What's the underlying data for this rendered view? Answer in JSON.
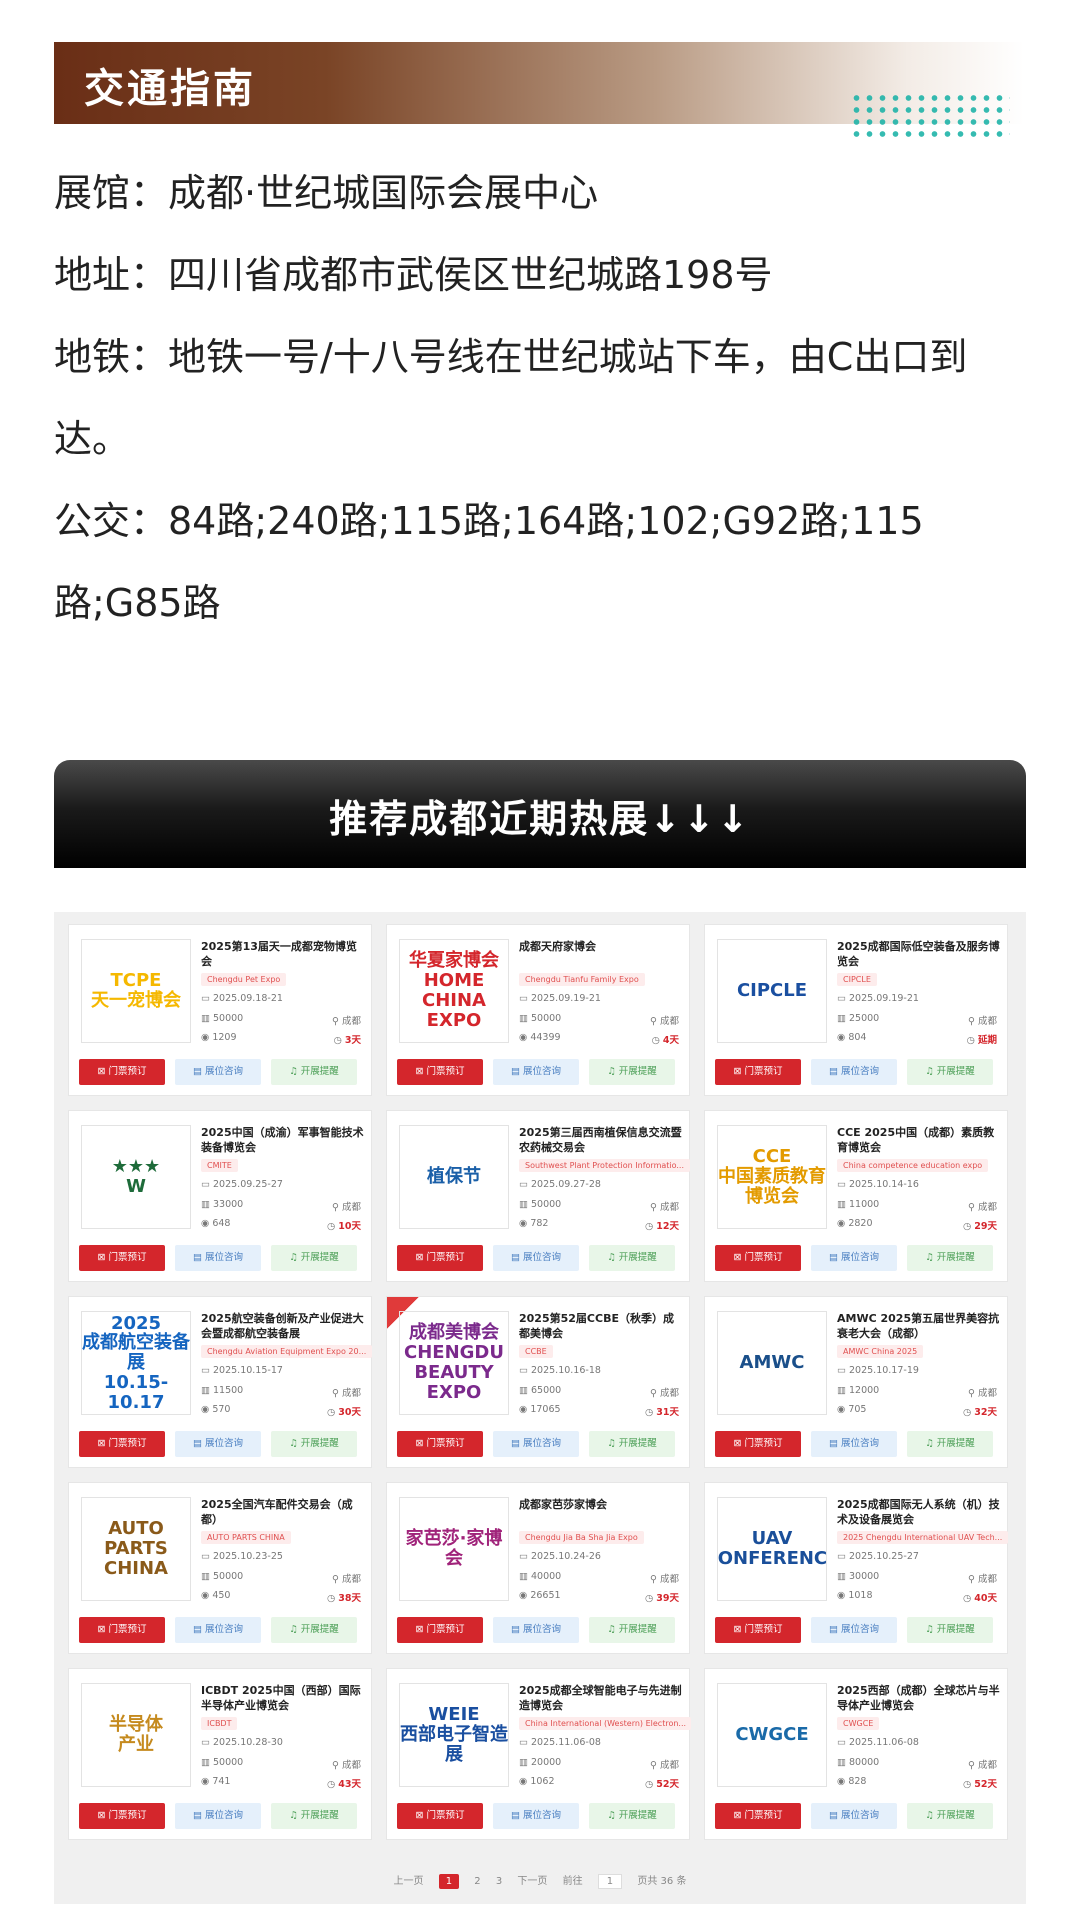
{
  "section_title": "交通指南",
  "venue": {
    "hall": "展馆：成都·世纪城国际会展中心",
    "address": "地址：四川省成都市武侯区世纪城路198号",
    "metro": "地铁：地铁一号/十八号线在世纪城站下车，由C出口到达。",
    "bus": "公交：84路;240路;115路;164路;102;G92路;115路;G85路"
  },
  "recommend_title": "推荐成都近期热展↓↓↓",
  "button_labels": {
    "ticket": "门票预订",
    "booth": "展位咨询",
    "remind": "开展提醒"
  },
  "cards": [
    {
      "logo": "TCPE\n天一宠博会",
      "logo_color": "#f5b800",
      "title": "2025第13届天一成都宠物博览会",
      "tag": "Chengdu Pet Expo",
      "date": "2025.09.18-21",
      "area": "50000",
      "city": "成都",
      "views": "1209",
      "days": "3天"
    },
    {
      "logo": "华夏家博会\nHOME CHINA EXPO",
      "logo_color": "#d4262c",
      "title": "成都天府家博会",
      "tag": "Chengdu Tianfu Family Expo",
      "date": "2025.09.19-21",
      "area": "50000",
      "city": "成都",
      "views": "44399",
      "days": "4天"
    },
    {
      "logo": "CIPCLE",
      "logo_color": "#1a4fa0",
      "title": "2025成都国际低空装备及服务博览会",
      "tag": "CIPCLE",
      "date": "2025.09.19-21",
      "area": "25000",
      "city": "成都",
      "views": "804",
      "days": "延期"
    },
    {
      "logo": "★★★\nW",
      "logo_color": "#1e6b3a",
      "title": "2025中国（成渝）军事智能技术装备博览会",
      "tag": "CMITE",
      "date": "2025.09.25-27",
      "area": "33000",
      "city": "成都",
      "views": "648",
      "days": "10天"
    },
    {
      "logo": "植保节",
      "logo_color": "#1a5fa8",
      "title": "2025第三届西南植保信息交流暨农药械交易会",
      "tag": "Southwest Plant Protection Informatio...",
      "date": "2025.09.27-28",
      "area": "50000",
      "city": "成都",
      "views": "782",
      "days": "12天"
    },
    {
      "logo": "CCE\n中国素质教育博览会",
      "logo_color": "#e39b00",
      "title": "CCE 2025中国（成都）素质教育博览会",
      "tag": "China competence education expo",
      "date": "2025.10.14-16",
      "area": "11000",
      "city": "成都",
      "views": "2820",
      "days": "29天"
    },
    {
      "logo": "2025\n成都航空装备展\n10.15-10.17",
      "logo_color": "#1565c0",
      "title": "2025航空装备创新及产业促进大会暨成都航空装备展",
      "tag": "Chengdu Aviation Equipment Expo 20...",
      "date": "2025.10.15-17",
      "area": "11500",
      "city": "成都",
      "views": "570",
      "days": "30天"
    },
    {
      "logo": "成都美博会\nCHENGDU\nBEAUTY EXPO",
      "logo_color": "#7b2a8c",
      "title": "2025第52届CCBE（秋季）成都美博会",
      "tag": "CCBE",
      "date": "2025.10.16-18",
      "area": "65000",
      "city": "成都",
      "views": "17065",
      "days": "31天"
    },
    {
      "logo": "AMWC",
      "logo_color": "#1a4f8a",
      "title": "AMWC 2025第五届世界美容抗衰老大会（成都）",
      "tag": "AMWC China 2025",
      "date": "2025.10.17-19",
      "area": "12000",
      "city": "成都",
      "views": "705",
      "days": "32天"
    },
    {
      "logo": "AUTO PARTS CHINA",
      "logo_color": "#8a5a1a",
      "title": "2025全国汽车配件交易会（成都）",
      "tag": "AUTO PARTS CHINA",
      "date": "2025.10.23-25",
      "area": "50000",
      "city": "成都",
      "views": "450",
      "days": "38天"
    },
    {
      "logo": "家芭莎·家博会",
      "logo_color": "#a0237a",
      "title": "成都家芭莎家博会",
      "tag": "Chengdu Jia Ba Sha Jia Expo",
      "date": "2025.10.24-26",
      "area": "40000",
      "city": "成都",
      "views": "26651",
      "days": "39天"
    },
    {
      "logo": "UAV CONFERENCE",
      "logo_color": "#1a4f9a",
      "title": "2025成都国际无人系统（机）技术及设备展览会",
      "tag": "2025 Chengdu International UAV Tech...",
      "date": "2025.10.25-27",
      "area": "30000",
      "city": "成都",
      "views": "1018",
      "days": "40天"
    },
    {
      "logo": "半导体\n产业",
      "logo_color": "#c58a1e",
      "title": "ICBDT 2025中国（西部）国际半导体产业博览会",
      "tag": "ICBDT",
      "date": "2025.10.28-30",
      "area": "50000",
      "city": "成都",
      "views": "741",
      "days": "43天"
    },
    {
      "logo": "WEIE\n西部电子智造展",
      "logo_color": "#1a4fa0",
      "title": "2025成都全球智能电子与先进制造博览会",
      "tag": "China International (Western) Electron...",
      "date": "2025.11.06-08",
      "area": "20000",
      "city": "成都",
      "views": "1062",
      "days": "52天"
    },
    {
      "logo": "CWGCE",
      "logo_color": "#1a6aa8",
      "title": "2025西部（成都）全球芯片与半导体产业博览会",
      "tag": "CWGCE",
      "date": "2025.11.06-08",
      "area": "80000",
      "city": "成都",
      "views": "828",
      "days": "52天"
    }
  ],
  "pagination": {
    "prev": "上一页",
    "pages": [
      "1",
      "2",
      "3"
    ],
    "next": "下一页",
    "goto": "前往",
    "page_input": "1",
    "total": "页共 36 条"
  }
}
